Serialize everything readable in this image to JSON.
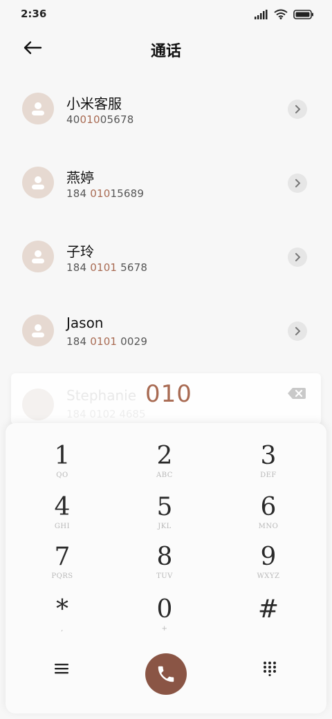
{
  "status": {
    "time": "2:36"
  },
  "header": {
    "title": "通话"
  },
  "contacts": [
    {
      "name": "小米客服",
      "num_pre": "40",
      "num_hl": "010",
      "num_post": "05678"
    },
    {
      "name": "燕婷",
      "num_pre": "184 ",
      "num_hl": "010",
      "num_post": "15689"
    },
    {
      "name": "子玲",
      "num_pre": "184 ",
      "num_hl": "0101",
      "num_post": " 5678"
    },
    {
      "name": "Jason",
      "num_pre": "184 ",
      "num_hl": "0101",
      "num_post": " 0029"
    }
  ],
  "ghost": {
    "name": "Stephanie",
    "number": "184 0102 4685"
  },
  "input": {
    "typed": "010"
  },
  "keys": [
    {
      "digit": "1",
      "letters": "QO"
    },
    {
      "digit": "2",
      "letters": "ABC"
    },
    {
      "digit": "3",
      "letters": "DEF"
    },
    {
      "digit": "4",
      "letters": "GHI"
    },
    {
      "digit": "5",
      "letters": "JKL"
    },
    {
      "digit": "6",
      "letters": "MNO"
    },
    {
      "digit": "7",
      "letters": "PQRS"
    },
    {
      "digit": "8",
      "letters": "TUV"
    },
    {
      "digit": "9",
      "letters": "WXYZ"
    },
    {
      "digit": "*",
      "letters": ","
    },
    {
      "digit": "0",
      "letters": "+"
    },
    {
      "digit": "#",
      "letters": ""
    }
  ],
  "colors": {
    "accent": "#a86a52",
    "call_button": "#8a5545",
    "avatar_bg": "#e6d9d1"
  },
  "icons": {
    "back": "arrow-left-icon",
    "backspace": "backspace-icon",
    "menu": "menu-icon",
    "call": "phone-icon",
    "dialpad": "dialpad-icon"
  }
}
